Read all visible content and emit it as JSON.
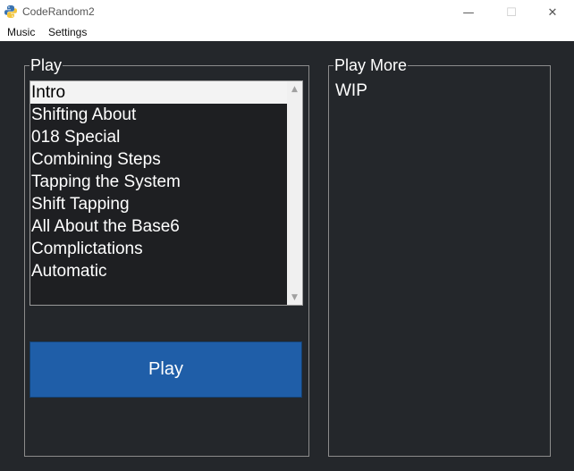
{
  "window": {
    "title": "CodeRandom2",
    "app_icon": "python-icon",
    "controls": {
      "minimize": "—",
      "maximize": "☐",
      "close": "✕"
    }
  },
  "menubar": {
    "items": [
      {
        "label": "Music"
      },
      {
        "label": "Settings"
      }
    ]
  },
  "play_frame": {
    "legend": "Play",
    "list": {
      "items": [
        "Intro",
        "Shifting About",
        "018 Special",
        "Combining Steps",
        "Tapping the System",
        "Shift Tapping",
        "All About the Base6",
        "Complictations",
        "Automatic"
      ],
      "selected_index": 0
    },
    "scroll": {
      "up_glyph": "▲",
      "down_glyph": "▼"
    },
    "play_button_label": "Play"
  },
  "more_frame": {
    "legend": "Play More",
    "content": "WIP"
  },
  "colors": {
    "background": "#24272b",
    "button": "#1f5ea8",
    "selection": "#f3f3f3",
    "text": "#ffffff"
  }
}
